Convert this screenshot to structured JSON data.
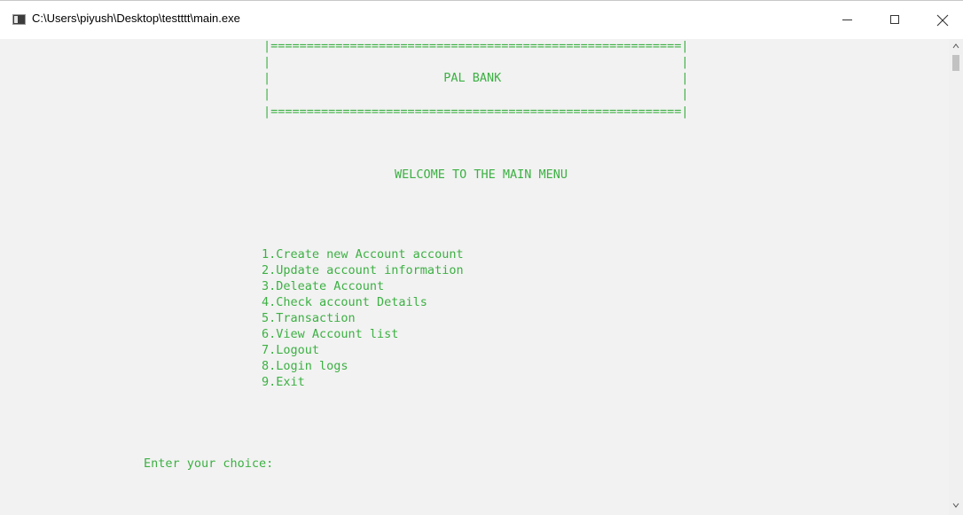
{
  "window": {
    "title": "C:\\Users\\piyush\\Desktop\\testttt\\main.exe"
  },
  "colors": {
    "console_text": "#3cb043",
    "console_background": "#f2f2f2"
  },
  "banner": {
    "top_border": "|=========================================================|",
    "blank_line_1": "|                                                         |",
    "title_line": "|                        PAL BANK                         |",
    "blank_line_2": "|                                                         |",
    "bottom_border": "|=========================================================|"
  },
  "welcome": "WELCOME TO THE MAIN MENU",
  "menu": {
    "items": [
      "1.Create new Account account",
      "2.Update account information",
      "3.Deleate Account",
      "4.Check account Details",
      "5.Transaction",
      "6.View Account list",
      "7.Logout",
      "8.Login logs",
      "9.Exit"
    ]
  },
  "prompt": "Enter your choice:",
  "icons": {
    "app": "console-app-icon",
    "minimize": "minimize-icon",
    "maximize": "maximize-icon",
    "close": "close-icon"
  }
}
